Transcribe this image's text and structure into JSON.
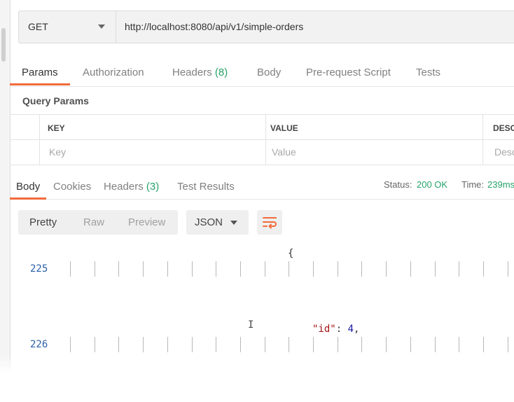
{
  "request": {
    "method": "GET",
    "url": "http://localhost:8080/api/v1/simple-orders"
  },
  "request_tabs": {
    "params": "Params",
    "authorization": "Authorization",
    "headers": "Headers",
    "headers_count": "(8)",
    "body": "Body",
    "pre_request_script": "Pre-request Script",
    "tests": "Tests"
  },
  "query_params": {
    "title": "Query Params",
    "columns": [
      "KEY",
      "VALUE",
      "DESC"
    ],
    "placeholders": [
      "Key",
      "Value",
      "Desc"
    ]
  },
  "response_tabs": {
    "body": "Body",
    "cookies": "Cookies",
    "headers": "Headers",
    "headers_count": "(3)",
    "test_results": "Test Results"
  },
  "status": {
    "label": "Status:",
    "value": "200 OK",
    "time_label": "Time:",
    "time_value": "239ms"
  },
  "response_toolbar": {
    "views": [
      "Pretty",
      "Raw",
      "Preview"
    ],
    "active_view": "Pretty",
    "format": "JSON",
    "wrap_icon": "wrap-lines-icon"
  },
  "code": {
    "lines": [
      {
        "number": "225",
        "content": "{"
      },
      {
        "number": "226",
        "key": "\"id\"",
        "separator": ": ",
        "value": "4",
        "trail": ","
      }
    ]
  },
  "colors": {
    "accent": "#f26b3a",
    "count_green": "#26a269",
    "line_number_blue": "#2b5fa8",
    "json_key": "#a31515"
  }
}
